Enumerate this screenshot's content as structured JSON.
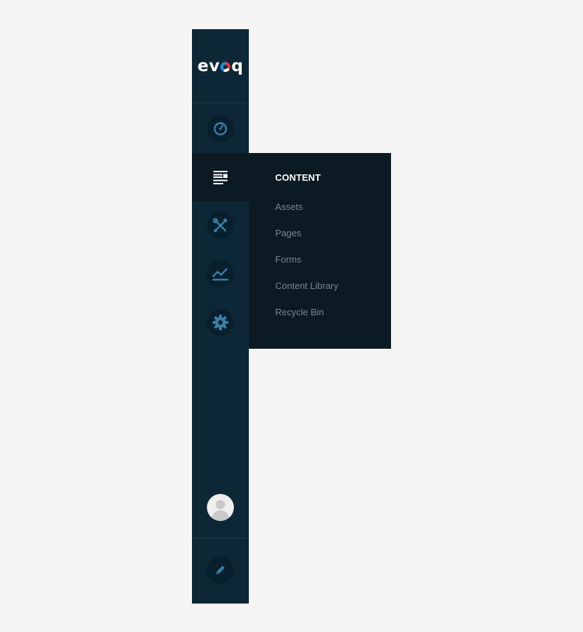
{
  "app": {
    "logo_text_left": "ev",
    "logo_text_right": "q",
    "logo_mark": "evoq-o-logo-mark"
  },
  "sidebar": {
    "items": [
      {
        "name": "dashboard",
        "icon": "speedometer-icon"
      },
      {
        "name": "content",
        "icon": "content-list-icon",
        "active": true
      },
      {
        "name": "manage",
        "icon": "tools-icon"
      },
      {
        "name": "analytics",
        "icon": "line-chart-icon"
      },
      {
        "name": "settings",
        "icon": "gear-icon"
      }
    ],
    "avatar_icon": "user-avatar-icon",
    "edit_icon": "pencil-icon"
  },
  "flyout": {
    "title": "CONTENT",
    "links": [
      "Assets",
      "Pages",
      "Forms",
      "Content Library",
      "Recycle Bin"
    ]
  },
  "colors": {
    "sidebar_bg": "#0e2736",
    "flyout_bg": "#0b1a23",
    "icon_accent": "#3a7fa7",
    "link_text": "#7c858b",
    "page_bg": "#f5f5f5"
  }
}
